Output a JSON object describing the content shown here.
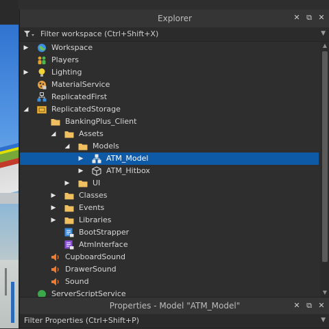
{
  "explorer": {
    "title": "Explorer",
    "filter_placeholder": "Filter workspace (Ctrl+Shift+X)",
    "header_icons": [
      "close-icon",
      "undock-icon",
      "panel-close-icon"
    ],
    "items": [
      {
        "label": "Workspace",
        "icon": "workspace-icon",
        "expand": "collapsed"
      },
      {
        "label": "Players",
        "icon": "players-icon",
        "expand": "none"
      },
      {
        "label": "Lighting",
        "icon": "lighting-icon",
        "expand": "collapsed"
      },
      {
        "label": "MaterialService",
        "icon": "material-service-icon",
        "expand": "none"
      },
      {
        "label": "ReplicatedFirst",
        "icon": "replicated-first-icon",
        "expand": "none"
      },
      {
        "label": "ReplicatedStorage",
        "icon": "replicated-storage-icon",
        "expand": "expanded"
      },
      {
        "label": "BankingPlus_Client",
        "icon": "folder-icon",
        "expand": "expanded"
      },
      {
        "label": "Assets",
        "icon": "folder-icon",
        "expand": "expanded"
      },
      {
        "label": "Models",
        "icon": "folder-icon",
        "expand": "expanded"
      },
      {
        "label": "ATM_Model",
        "icon": "model-icon",
        "expand": "collapsed",
        "selected": true
      },
      {
        "label": "ATM_Hitbox",
        "icon": "part-icon",
        "expand": "collapsed"
      },
      {
        "label": "UI",
        "icon": "folder-icon",
        "expand": "collapsed"
      },
      {
        "label": "Classes",
        "icon": "folder-icon",
        "expand": "collapsed"
      },
      {
        "label": "Events",
        "icon": "folder-icon",
        "expand": "collapsed"
      },
      {
        "label": "Libraries",
        "icon": "folder-icon",
        "expand": "collapsed"
      },
      {
        "label": "BootStrapper",
        "icon": "local-script-icon",
        "expand": "none"
      },
      {
        "label": "AtmInterface",
        "icon": "module-script-icon",
        "expand": "none"
      },
      {
        "label": "CupboardSound",
        "icon": "sound-icon",
        "expand": "none"
      },
      {
        "label": "DrawerSound",
        "icon": "sound-icon",
        "expand": "none"
      },
      {
        "label": "Sound",
        "icon": "sound-icon",
        "expand": "none"
      },
      {
        "label": "ServerScriptService",
        "icon": "server-script-service-icon",
        "expand": "none"
      }
    ]
  },
  "properties": {
    "title": "Properties - Model \"ATM_Model\"",
    "filter_placeholder": "Filter Properties (Ctrl+Shift+P)"
  },
  "colors": {
    "selection": "#0f5aa6",
    "panel_bg": "#2e2e2e",
    "folder": "#f0c060"
  }
}
